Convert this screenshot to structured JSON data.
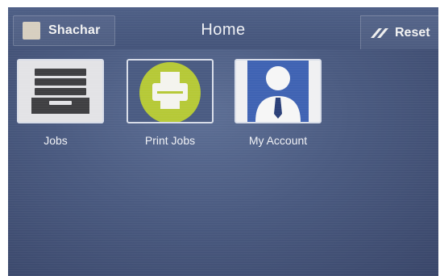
{
  "header": {
    "user_name": "Shachar",
    "title": "Home",
    "reset_label": "Reset",
    "user_icon": "user-avatar-icon",
    "reset_icon": "reset-icon"
  },
  "tiles": [
    {
      "label": "Jobs",
      "icon": "job-tray-icon",
      "color": "#e3e3e6"
    },
    {
      "label": "Print Jobs",
      "icon": "printer-icon",
      "color": "#b6c937"
    },
    {
      "label": "My Account",
      "icon": "account-person-icon",
      "color": "#3f63b3"
    }
  ]
}
